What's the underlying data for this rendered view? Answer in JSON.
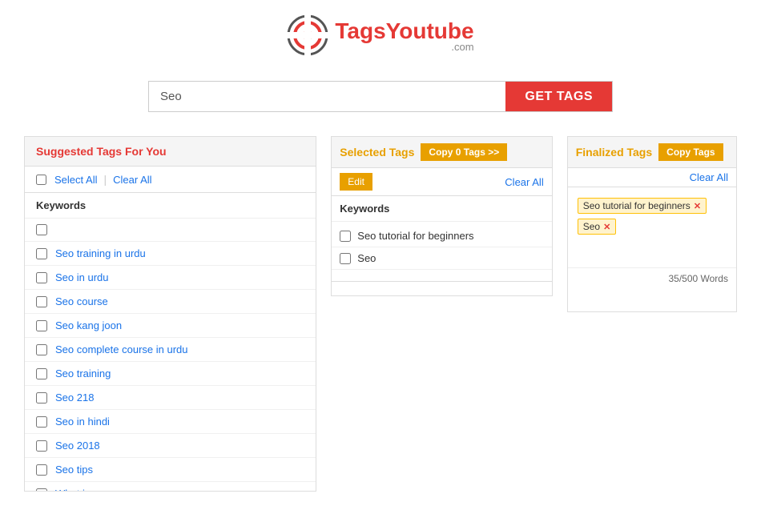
{
  "header": {
    "logo_text": "TagsYoutube",
    "logo_com": ".com",
    "logo_brand": "Tags"
  },
  "search": {
    "input_value": "Seo",
    "input_placeholder": "",
    "get_tags_label": "GET TAGS"
  },
  "suggested": {
    "title": "Suggested Tags For You",
    "select_all_label": "Select All",
    "clear_all_label": "Clear All",
    "keywords_header": "Keywords",
    "items": [
      "",
      "Seo training in urdu",
      "Seo in urdu",
      "Seo course",
      "Seo kang joon",
      "Seo complete course in urdu",
      "Seo training",
      "Seo 218",
      "Seo in hindi",
      "Seo 2018",
      "Seo tips",
      "What is seo"
    ]
  },
  "selected": {
    "title": "Selected Tags",
    "copy_label": "Copy 0 Tags >>",
    "edit_label": "Edit",
    "clear_all_label": "Clear All",
    "keywords_header": "Keywords",
    "items": [
      "Seo tutorial for beginners",
      "Seo"
    ]
  },
  "finalized": {
    "title": "Finalized Tags",
    "copy_label": "Copy Tags",
    "clear_all_label": "Clear All",
    "chips": [
      "Seo tutorial for beginners",
      "Seo"
    ],
    "word_count": "35/500 Words"
  }
}
